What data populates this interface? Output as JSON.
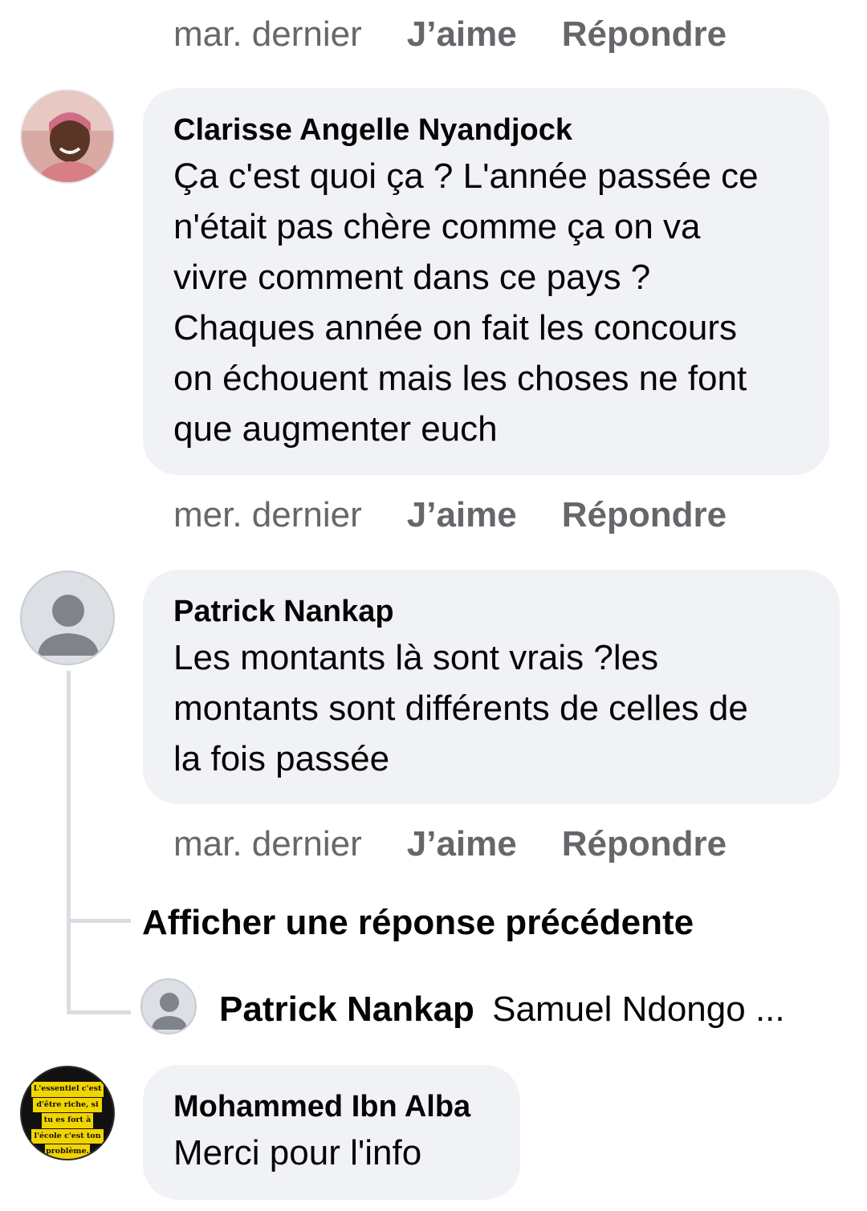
{
  "actions": {
    "like_label": "J’aime",
    "reply_label": "Répondre"
  },
  "comments": [
    {
      "time": "mar. dernier"
    },
    {
      "author": "Clarisse Angelle Nyandjock",
      "lines": [
        "Ça c'est quoi ça ? L'année passée ce",
        "n'était pas chère comme ça on va",
        "vivre comment dans ce pays ?",
        "Chaques année on fait les concours",
        "on échouent mais les choses ne font",
        "que augmenter euch"
      ],
      "time": "mer. dernier"
    },
    {
      "author": "Patrick Nankap",
      "lines": [
        "Les montants là sont vrais ?les",
        "montants sont différents de celles de",
        "la fois passée"
      ],
      "time": "mar. dernier"
    },
    {
      "author": "Mohammed Ibn Alba",
      "lines": [
        "Merci pour l'info"
      ],
      "avatar_text": [
        "L'essentiel c'est",
        "d'être riche, si",
        "tu es fort à",
        "l'école c'est ton",
        "problème."
      ]
    }
  ],
  "replies": {
    "show_previous_label": "Afficher une réponse précédente",
    "preview_author": "Patrick Nankap",
    "preview_text": "Samuel Ndongo ..."
  },
  "colors": {
    "bubble": "#f0f2f5",
    "meta": "#65676b",
    "thread": "#dadde1"
  }
}
